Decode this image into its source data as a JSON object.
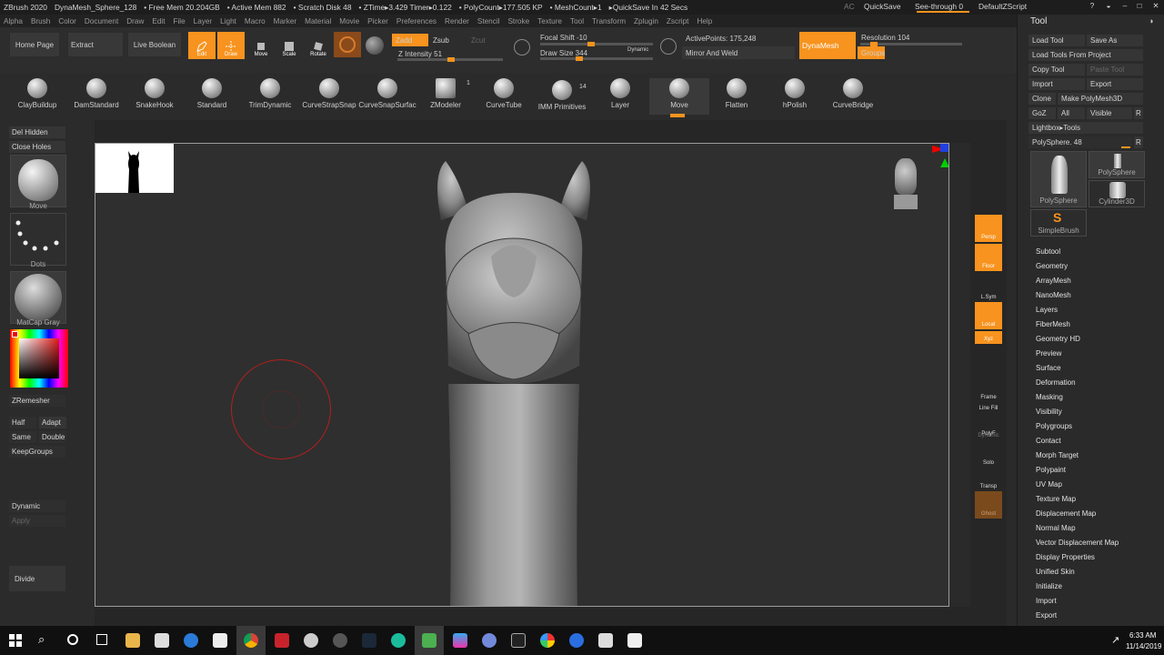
{
  "titlebar": {
    "segments": [
      "ZBrush 2020",
      "DynaMesh_Sphere_128",
      "• Free Mem 20.204GB",
      "• Active Mem 882",
      "• Scratch Disk 48",
      "• ZTime▸3.429 Timer▸0.122",
      "• PolyCount▸177.505 KP",
      "• MeshCount▸1",
      "▸QuickSave In 42 Secs"
    ],
    "ac": "AC",
    "quicksave": "QuickSave",
    "see_through": "See-through  0",
    "script": "DefaultZScript",
    "controls": [
      "?",
      "◒",
      "–",
      "□",
      "✕"
    ]
  },
  "menubar": [
    "Alpha",
    "Brush",
    "Color",
    "Document",
    "Draw",
    "Edit",
    "File",
    "Layer",
    "Light",
    "Macro",
    "Marker",
    "Material",
    "Movie",
    "Picker",
    "Preferences",
    "Render",
    "Stencil",
    "Stroke",
    "Texture",
    "Tool",
    "Transform",
    "Zplugin",
    "Zscript",
    "Help"
  ],
  "toolbar": {
    "home_page": "Home Page",
    "extract": "Extract",
    "live_boolean": "Live Boolean",
    "edit": "Edit",
    "draw": "Draw",
    "move": "Move",
    "scale": "Scale",
    "rotate": "Rotate",
    "zadd": "Zadd",
    "zsub": "Zsub",
    "zcut": "Zcut",
    "z_intensity": "Z Intensity 51",
    "focal_shift": "Focal Shift -10",
    "draw_size": "Draw Size 344",
    "dynamic": "Dynamic",
    "active_points": "ActivePoints: 175,248",
    "mirror_weld": "Mirror And Weld",
    "dynamesh": "DynaMesh",
    "resolution": "Resolution 104",
    "groups": "Groups",
    "z_intensity_level": 0.51,
    "focal_shift_level": 0.45,
    "draw_size_level": 0.34,
    "resolution_level": 0.104
  },
  "brushes": [
    {
      "label": "ClayBuildup"
    },
    {
      "label": "DamStandard"
    },
    {
      "label": "SnakeHook"
    },
    {
      "label": "Standard"
    },
    {
      "label": "TrimDynamic"
    },
    {
      "label": "CurveStrapSnap"
    },
    {
      "label": "CurveSnapSurfac"
    },
    {
      "label": "ZModeler",
      "badge": "1"
    },
    {
      "label": "CurveTube"
    },
    {
      "label": "IMM Primitives",
      "badge": "14"
    },
    {
      "label": "Layer"
    },
    {
      "label": "Move"
    },
    {
      "label": "Flatten"
    },
    {
      "label": "hPolish"
    },
    {
      "label": "CurveBridge"
    }
  ],
  "left": {
    "del_hidden": "Del Hidden",
    "close_holes": "Close Holes",
    "move": "Move",
    "dots": "Dots",
    "matcap": "MatCap Gray",
    "zremesher": "ZRemesher",
    "half": "Half",
    "adapt": "Adapt",
    "same": "Same",
    "double": "Double",
    "keepgroups": "KeepGroups",
    "dynamic": "Dynamic",
    "apply": "Apply",
    "divide": "Divide"
  },
  "right_shelf": {
    "persp": "Persp",
    "floor": "Floor",
    "lsym": "L.Sym",
    "local": "Local",
    "xyz": "Xyz",
    "frame": "Frame",
    "line_fill": "Line Fill",
    "polyf": "PolyF",
    "dynamic": "Dynamic",
    "solo": "Solo",
    "transp": "Transp",
    "ghost": "Ghost"
  },
  "tool_panel": {
    "title": "Tool",
    "load_tool": "Load Tool",
    "save_as": "Save As",
    "load_from_project": "Load Tools From Project",
    "copy_tool": "Copy Tool",
    "paste_tool": "Paste Tool",
    "import": "Import",
    "export": "Export",
    "clone": "Clone",
    "make_polymesh": "Make PolyMesh3D",
    "goz": "GoZ",
    "all": "All",
    "visible": "Visible",
    "r": "R",
    "lightbox": "Lightbox▸Tools",
    "polysphere_slider": "PolySphere. 48",
    "thumbs": [
      "PolySphere",
      "PolySphere",
      "Cylinder3D",
      "SimpleBrush"
    ],
    "items": [
      "Subtool",
      "Geometry",
      "ArrayMesh",
      "NanoMesh",
      "Layers",
      "FiberMesh",
      "Geometry HD",
      "Preview",
      "Surface",
      "Deformation",
      "Masking",
      "Visibility",
      "Polygroups",
      "Contact",
      "Morph Target",
      "Polypaint",
      "UV Map",
      "Texture Map",
      "Displacement Map",
      "Normal Map",
      "Vector Displacement Map",
      "Display Properties",
      "Unified Skin",
      "Initialize",
      "Import",
      "Export"
    ]
  },
  "taskbar": {
    "time": "6:33 AM",
    "date": "11/14/2019"
  },
  "colors": {
    "accent": "#f7931e",
    "brush_ring": "#b02020"
  }
}
